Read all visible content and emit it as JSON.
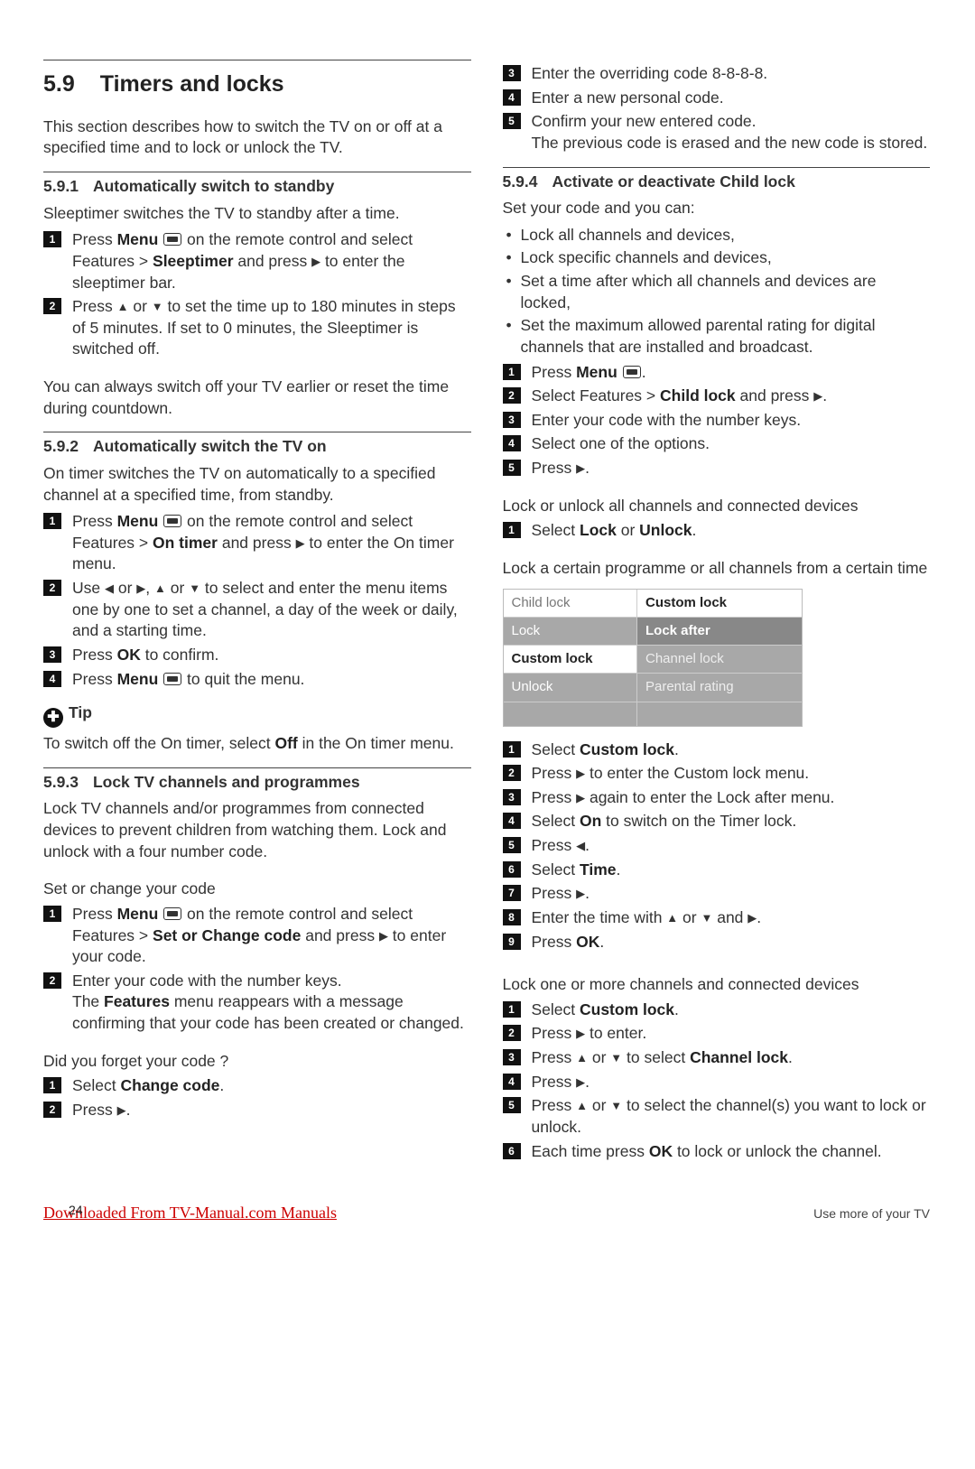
{
  "title": {
    "num": "5.9",
    "text": "Timers and locks"
  },
  "intro": "This section describes how to switch the TV on or off at a specified time and to lock or unlock the TV.",
  "s591": {
    "num": "5.9.1",
    "title": "Automatically switch to standby",
    "intro": "Sleeptimer switches the TV to standby after a time.",
    "step1a": "Press ",
    "step1b": "Menu",
    "step1c": " on the remote control and select Features > ",
    "step1d": "Sleeptimer",
    "step1e": " and press ",
    "step1f": " to enter the sleeptimer bar.",
    "step2a": "Press ",
    "step2b": " or ",
    "step2c": " to set the time up to 180 minutes in steps of 5 minutes. If set to 0 minutes, the Sleeptimer is switched off.",
    "after": "You can always switch off your TV earlier or reset the time during countdown."
  },
  "s592": {
    "num": "5.9.2",
    "title": "Automatically switch the TV on",
    "intro": "On timer switches the TV on automatically to a specified channel at a specified time, from standby.",
    "s1a": "Press ",
    "s1b": "Menu",
    "s1c": " on the remote control and select Features > ",
    "s1d": "On timer",
    "s1e": " and press ",
    "s1f": " to enter the On timer menu.",
    "s2a": "Use ",
    "s2b": " or ",
    "s2c": ", ",
    "s2d": " or ",
    "s2e": " to select and enter the menu items one by one to set a channel, a day of the week or daily, and a starting time.",
    "s3a": "Press ",
    "s3b": "OK",
    "s3c": " to confirm.",
    "s4a": "Press ",
    "s4b": "Menu",
    "s4c": " to quit the menu.",
    "tip_label": "Tip",
    "tip_a": "To switch off the On timer, select ",
    "tip_b": "Off",
    "tip_c": " in the On timer menu."
  },
  "s593": {
    "num": "5.9.3",
    "title": "Lock TV channels and programmes",
    "intro": "Lock TV channels and/or programmes from connected devices to prevent children from watching them. Lock and unlock with a four number code.",
    "sc_head": "Set or change your code",
    "sc1a": "Press ",
    "sc1b": "Menu",
    "sc1c": " on the remote control and select Features > ",
    "sc1d": "Set or Change code",
    "sc1e": " and press ",
    "sc1f": " to enter your code.",
    "sc2a": "Enter your code with the number keys.",
    "sc2b": "The ",
    "sc2c": "Features",
    "sc2d": " menu reappears with a message confirming that your code has been created or changed.",
    "fc_head": "Did you forget your code ?",
    "fc1a": "Select ",
    "fc1b": "Change code",
    "fc1c": ".",
    "fc2a": "Press ",
    "fc2b": "."
  },
  "col2_top": {
    "s3": "Enter the overriding code 8-8-8-8.",
    "s4": "Enter a new personal code.",
    "s5a": "Confirm your new entered code.",
    "s5b": "The previous code is erased and the new code is stored."
  },
  "s594": {
    "num": "5.9.4",
    "title": "Activate or deactivate Child lock",
    "intro": "Set your code and you can:",
    "b1": "Lock all channels and devices,",
    "b2": "Lock specific channels and devices,",
    "b3": "Set a time after which all channels and devices are locked,",
    "b4": "Set the maximum allowed parental rating for digital channels that are installed and broadcast.",
    "n1a": "Press ",
    "n1b": "Menu",
    "n1c": ".",
    "n2a": "Select Features > ",
    "n2b": "Child lock",
    "n2c": " and press ",
    "n2d": ".",
    "n3": "Enter your code with the number keys.",
    "n4": "Select one of the options.",
    "n5a": "Press ",
    "n5b": "."
  },
  "lu_head": "Lock or unlock all channels and connected devices",
  "lu1a": "Select ",
  "lu1b": "Lock",
  "lu1c": " or ",
  "lu1d": "Unlock",
  "lu1e": ".",
  "ct_head": "Lock a certain programme or all channels from a certain time",
  "table": {
    "l_hdr": "Child lock",
    "r_hdr": "Custom lock",
    "l1": "Lock",
    "l2": "Custom lock",
    "l3": "Unlock",
    "r1": "Lock after",
    "r2": "Channel lock",
    "r3": "Parental rating"
  },
  "ct": {
    "s1a": "Select ",
    "s1b": "Custom lock",
    "s1c": ".",
    "s2a": "Press ",
    "s2b": " to enter the Custom lock menu.",
    "s3a": "Press ",
    "s3b": " again to enter the Lock after menu.",
    "s4a": "Select ",
    "s4b": "On",
    "s4c": " to switch on the Timer lock.",
    "s5a": "Press ",
    "s5b": ".",
    "s6a": "Select ",
    "s6b": "Time",
    "s6c": ".",
    "s7a": "Press ",
    "s7b": ".",
    "s8a": "Enter the time with ",
    "s8b": " or ",
    "s8c": " and ",
    "s8d": ".",
    "s9a": "Press ",
    "s9b": "OK",
    "s9c": "."
  },
  "lom_head": "Lock one or more channels and connected devices",
  "lom": {
    "s1a": "Select ",
    "s1b": "Custom lock",
    "s1c": ".",
    "s2a": "Press ",
    "s2b": " to enter.",
    "s3a": "Press ",
    "s3b": " or ",
    "s3c": " to select ",
    "s3d": "Channel lock",
    "s3e": ".",
    "s4a": "Press ",
    "s4b": ".",
    "s5a": "Press ",
    "s5b": " or ",
    "s5c": " to select the channel(s) you want to lock or unlock.",
    "s6a": "Each time press ",
    "s6b": "OK",
    "s6c": " to lock or unlock the channel."
  },
  "footer": {
    "dl": "Downloaded From TV-Manual.com Manuals",
    "pg": "24",
    "right": "Use more of your TV"
  }
}
